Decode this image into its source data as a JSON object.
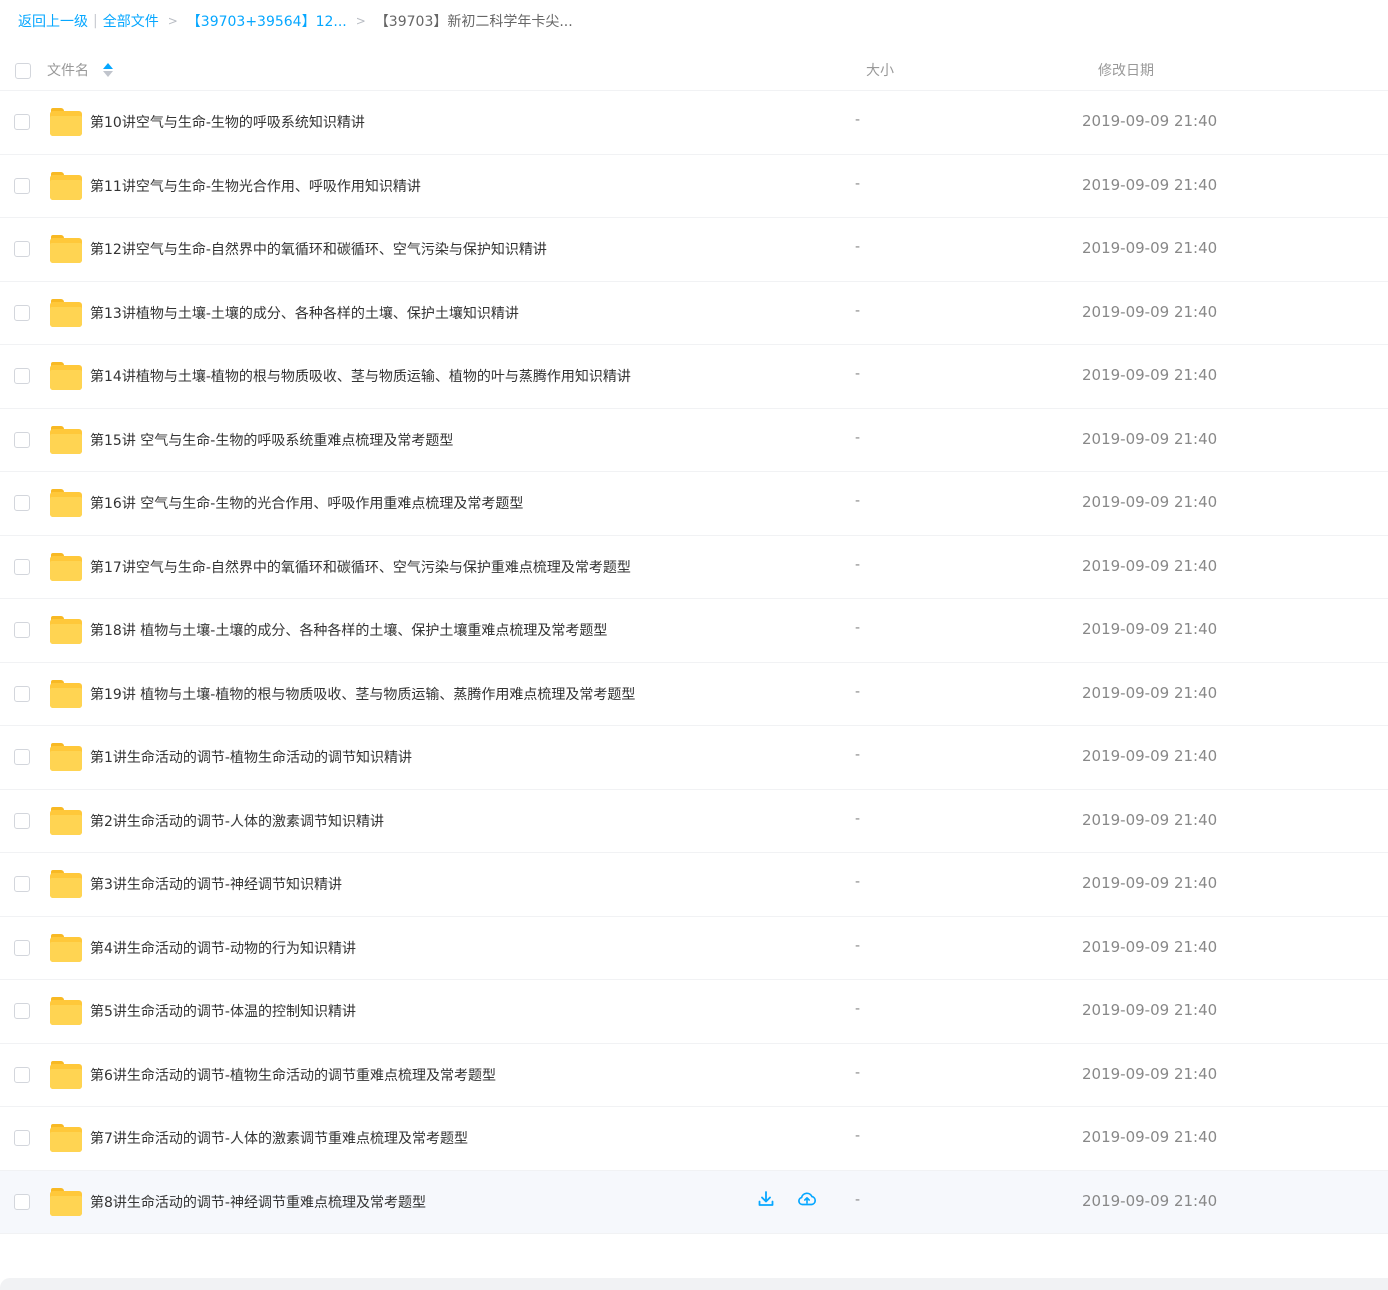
{
  "breadcrumb": {
    "back": "返回上一级",
    "all_files": "全部文件",
    "parent": "【39703+39564】12...",
    "current": "【39703】新初二科学年卡尖..."
  },
  "header": {
    "name": "文件名",
    "size": "大小",
    "date": "修改日期"
  },
  "colors": {
    "link": "#06a7ff",
    "folder": "#ffc83a",
    "hover_row": "#f6f8fc"
  },
  "rows": [
    {
      "name": "第10讲空气与生命-生物的呼吸系统知识精讲",
      "size": "-",
      "date": "2019-09-09 21:40"
    },
    {
      "name": "第11讲空气与生命-生物光合作用、呼吸作用知识精讲",
      "size": "-",
      "date": "2019-09-09 21:40"
    },
    {
      "name": "第12讲空气与生命-自然界中的氧循环和碳循环、空气污染与保护知识精讲",
      "size": "-",
      "date": "2019-09-09 21:40"
    },
    {
      "name": "第13讲植物与土壤-土壤的成分、各种各样的土壤、保护土壤知识精讲",
      "size": "-",
      "date": "2019-09-09 21:40"
    },
    {
      "name": "第14讲植物与土壤-植物的根与物质吸收、茎与物质运输、植物的叶与蒸腾作用知识精讲",
      "size": "-",
      "date": "2019-09-09 21:40"
    },
    {
      "name": "第15讲 空气与生命-生物的呼吸系统重难点梳理及常考题型",
      "size": "-",
      "date": "2019-09-09 21:40"
    },
    {
      "name": "第16讲 空气与生命-生物的光合作用、呼吸作用重难点梳理及常考题型",
      "size": "-",
      "date": "2019-09-09 21:40"
    },
    {
      "name": "第17讲空气与生命-自然界中的氧循环和碳循环、空气污染与保护重难点梳理及常考题型",
      "size": "-",
      "date": "2019-09-09 21:40"
    },
    {
      "name": "第18讲 植物与土壤-土壤的成分、各种各样的土壤、保护土壤重难点梳理及常考题型",
      "size": "-",
      "date": "2019-09-09 21:40"
    },
    {
      "name": "第19讲 植物与土壤-植物的根与物质吸收、茎与物质运输、蒸腾作用难点梳理及常考题型",
      "size": "-",
      "date": "2019-09-09 21:40"
    },
    {
      "name": "第1讲生命活动的调节-植物生命活动的调节知识精讲",
      "size": "-",
      "date": "2019-09-09 21:40"
    },
    {
      "name": "第2讲生命活动的调节-人体的激素调节知识精讲",
      "size": "-",
      "date": "2019-09-09 21:40"
    },
    {
      "name": "第3讲生命活动的调节-神经调节知识精讲",
      "size": "-",
      "date": "2019-09-09 21:40"
    },
    {
      "name": "第4讲生命活动的调节-动物的行为知识精讲",
      "size": "-",
      "date": "2019-09-09 21:40"
    },
    {
      "name": "第5讲生命活动的调节-体温的控制知识精讲",
      "size": "-",
      "date": "2019-09-09 21:40"
    },
    {
      "name": "第6讲生命活动的调节-植物生命活动的调节重难点梳理及常考题型",
      "size": "-",
      "date": "2019-09-09 21:40"
    },
    {
      "name": "第7讲生命活动的调节-人体的激素调节重难点梳理及常考题型",
      "size": "-",
      "date": "2019-09-09 21:40"
    },
    {
      "name": "第8讲生命活动的调节-神经调节重难点梳理及常考题型",
      "size": "-",
      "date": "2019-09-09 21:40"
    }
  ]
}
